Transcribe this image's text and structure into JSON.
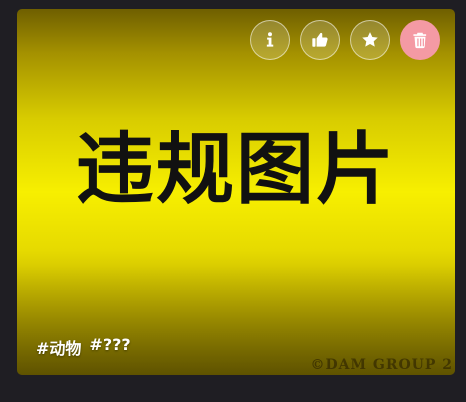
{
  "image": {
    "banner_text": "违规图片",
    "watermark": "©DAM GROUP 2"
  },
  "actions": [
    {
      "name": "info",
      "icon": "info-icon"
    },
    {
      "name": "like",
      "icon": "thumbs-up-icon"
    },
    {
      "name": "favorite",
      "icon": "star-icon"
    },
    {
      "name": "delete",
      "icon": "trash-icon"
    }
  ],
  "tags": [
    "#动物",
    "#???"
  ],
  "colors": {
    "page_bg": "#1f1e23",
    "image_yellow": "#f7ef00",
    "delete_button": "#f49aa4"
  }
}
